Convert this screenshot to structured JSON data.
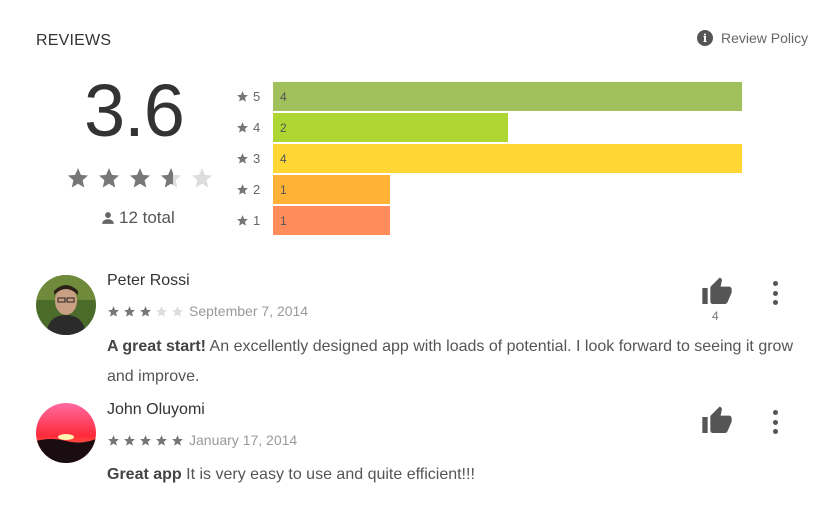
{
  "header": {
    "title": "REVIEWS",
    "policy_label": "Review Policy",
    "policy_icon": "info-icon"
  },
  "summary": {
    "score": "3.6",
    "rating_value": 3.6,
    "total_label": "12 total",
    "user_icon": "person-icon"
  },
  "histogram": [
    {
      "stars": "5",
      "count": "4",
      "fraction": 1.0,
      "color": "#9fc05a"
    },
    {
      "stars": "4",
      "count": "2",
      "fraction": 0.5,
      "color": "#add633"
    },
    {
      "stars": "3",
      "count": "4",
      "fraction": 1.0,
      "color": "#ffd633"
    },
    {
      "stars": "2",
      "count": "1",
      "fraction": 0.25,
      "color": "#ffb235"
    },
    {
      "stars": "1",
      "count": "1",
      "fraction": 0.25,
      "color": "#ff8c5a"
    }
  ],
  "reviews": [
    {
      "name": "Peter Rossi",
      "rating": 3,
      "date": "September 7, 2014",
      "title": "A great start!",
      "body": "An excellently designed app with loads of potential. I look forward to seeing it grow and improve.",
      "helpful_count": "4"
    },
    {
      "name": "John Oluyomi",
      "rating": 5,
      "date": "January 17, 2014",
      "title": "Great app",
      "body": "It is very easy to use and quite efficient!!!",
      "helpful_count": ""
    }
  ],
  "colors": {
    "star_filled": "#777777",
    "star_empty": "#dddddd",
    "thumb": "#555555"
  }
}
